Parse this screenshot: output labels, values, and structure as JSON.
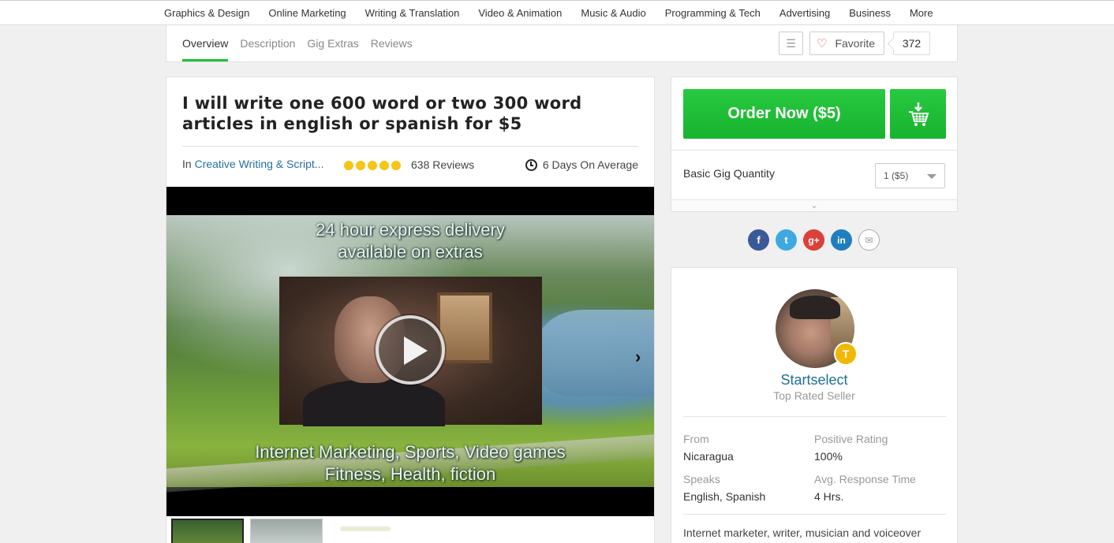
{
  "categories": [
    "Graphics & Design",
    "Online Marketing",
    "Writing & Translation",
    "Video & Animation",
    "Music & Audio",
    "Programming & Tech",
    "Advertising",
    "Business",
    "More"
  ],
  "gig_nav": {
    "tabs": [
      "Overview",
      "Description",
      "Gig Extras",
      "Reviews"
    ],
    "favorite_label": "Favorite",
    "favorite_count": "372"
  },
  "gig": {
    "title": "I will write one 600 word or two 300 word articles in english or spanish for $5",
    "category_prefix": "In",
    "category": "Creative Writing & Script...",
    "rating_stars": 5,
    "reviews": "638 Reviews",
    "delivery": "6 Days On Average",
    "video": {
      "overlay_top_line1": "24 hour express delivery",
      "overlay_top_line2": "available on extras",
      "overlay_bottom_line1": "Internet Marketing, Sports, Video games",
      "overlay_bottom_line2": "Fitness, Health, fiction"
    }
  },
  "order": {
    "button_label": "Order Now ($5)",
    "quantity_label": "Basic Gig Quantity",
    "quantity_value": "1 ($5)"
  },
  "social": [
    "f",
    "t",
    "g+",
    "in",
    "✉"
  ],
  "seller": {
    "badge": "T",
    "name": "Startselect",
    "level": "Top Rated Seller",
    "stats": {
      "from_label": "From",
      "from_value": "Nicaragua",
      "rating_label": "Positive Rating",
      "rating_value": "100%",
      "speaks_label": "Speaks",
      "speaks_value": "English, Spanish",
      "response_label": "Avg. Response Time",
      "response_value": "4 Hrs."
    },
    "bio": "Internet marketer, writer, musician and voiceover"
  },
  "colors": {
    "brand_green": "#1dbf36",
    "link_blue": "#25709f",
    "star_yellow": "#f5c518"
  }
}
